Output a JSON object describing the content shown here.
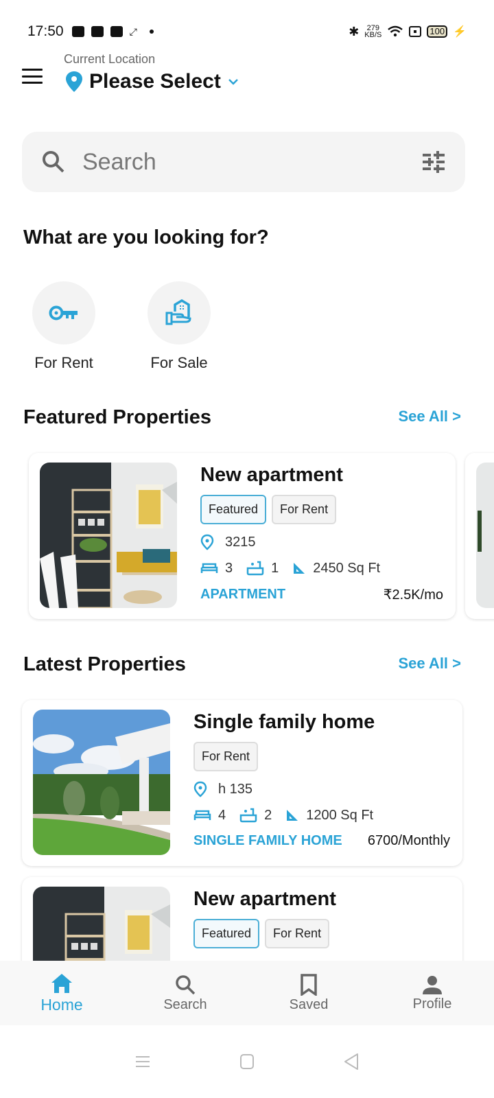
{
  "status_bar": {
    "time": "17:50",
    "net_speed_value": "279",
    "net_speed_unit": "KB/S",
    "battery": "100"
  },
  "header": {
    "location_label": "Current Location",
    "location_value": "Please Select"
  },
  "search": {
    "placeholder": "Search"
  },
  "categories": {
    "title": "What are you looking for?",
    "items": [
      {
        "label": "For Rent",
        "icon": "key-icon"
      },
      {
        "label": "For Sale",
        "icon": "house-hand-icon"
      }
    ]
  },
  "featured": {
    "title": "Featured Properties",
    "see_all": "See All >",
    "items": [
      {
        "title": "New apartment",
        "tags": [
          "Featured",
          "For Rent"
        ],
        "location": "3215",
        "bedrooms": "3",
        "bathrooms": "1",
        "area": "2450 Sq Ft",
        "type": "APARTMENT",
        "price": "₹2.5K/mo"
      }
    ]
  },
  "latest": {
    "title": "Latest Properties",
    "see_all": "See All >",
    "items": [
      {
        "title": "Single family home",
        "tags": [
          "For Rent"
        ],
        "location": "h 135",
        "bedrooms": "4",
        "bathrooms": "2",
        "area": "1200 Sq Ft",
        "type": "SINGLE FAMILY HOME",
        "price": "6700/Monthly"
      },
      {
        "title": "New apartment",
        "tags": [
          "Featured",
          "For Rent"
        ]
      }
    ]
  },
  "bottom_nav": {
    "items": [
      {
        "label": "Home",
        "active": true
      },
      {
        "label": "Search",
        "active": false
      },
      {
        "label": "Saved",
        "active": false
      },
      {
        "label": "Profile",
        "active": false
      }
    ]
  },
  "colors": {
    "accent": "#2aa3d6",
    "text": "#111111",
    "muted": "#666666",
    "surface": "#f4f4f4"
  }
}
